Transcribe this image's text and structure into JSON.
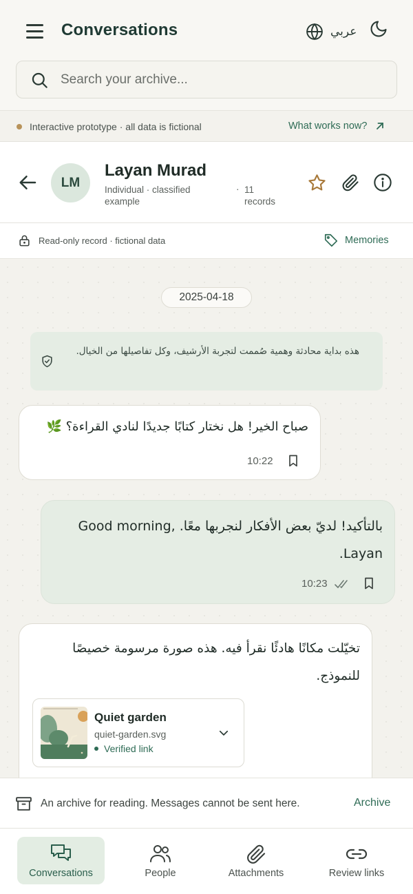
{
  "header": {
    "title": "Conversations",
    "language_label": "عربي",
    "search_placeholder": "Search your archive..."
  },
  "prototype_banner": {
    "text": "Interactive prototype · all data is fictional",
    "link": "What works now?"
  },
  "contact": {
    "initials": "LM",
    "name": "Layan Murad",
    "type": "Individual · classified example",
    "separator": "·",
    "records": "11 records"
  },
  "record_bar": {
    "readonly_text": "Read-only record · fictional data",
    "memories_label": "Memories"
  },
  "chat": {
    "date": "2025-04-18",
    "notice": "هذه بداية محادثة وهمية صُممت لتجربة الأرشيف، وكل تفاصيلها من الخيال.",
    "messages": [
      {
        "text": "صباح الخير! هل نختار كتابًا جديدًا لنادي القراءة؟ 🌿",
        "time": "10:22"
      },
      {
        "text": "بالتأكيد! لديّ بعض الأفكار لنجربها معًا. Good morning, Layan.",
        "time": "10:23"
      },
      {
        "text": "تخيّلت مكانًا هادئًا نقرأ فيه. هذه صورة مرسومة خصيصًا للنموذج."
      }
    ],
    "attachment": {
      "title": "Quiet garden",
      "file": "quiet-garden.svg",
      "status": "Verified link"
    }
  },
  "archive_bar": {
    "text": "An archive for reading. Messages cannot be sent here.",
    "link": "Archive"
  },
  "bottom_nav": [
    {
      "label": "Conversations",
      "icon": "chat-icon",
      "active": true
    },
    {
      "label": "People",
      "icon": "people-icon",
      "active": false
    },
    {
      "label": "Attachments",
      "icon": "paperclip-icon",
      "active": false
    },
    {
      "label": "Review links",
      "icon": "link-icon",
      "active": false
    }
  ],
  "colors": {
    "accent": "#2e6b55",
    "background": "#f6f5f0",
    "bubble_out": "#e5ede4",
    "active_nav": "#e3ede3",
    "star": "#a8793a"
  }
}
